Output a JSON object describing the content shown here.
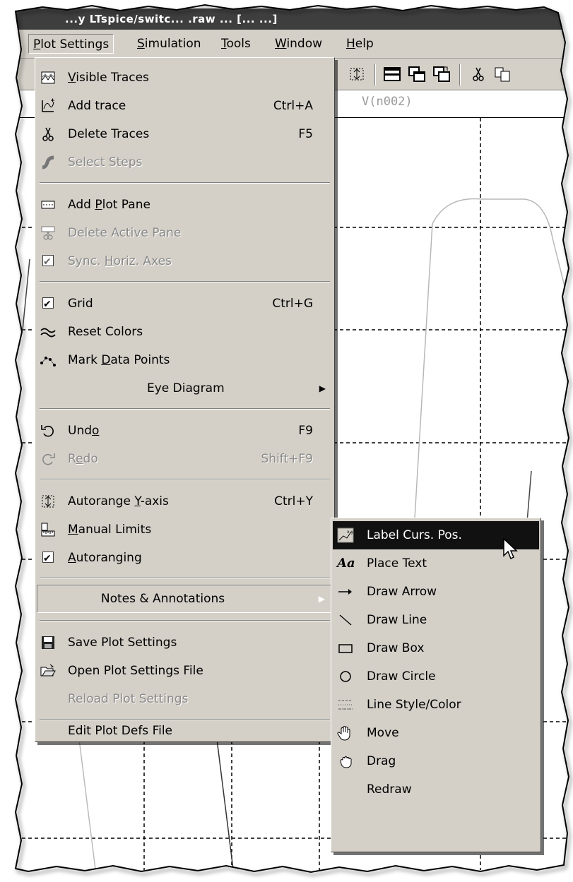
{
  "window": {
    "title": "...y LTspice/switc... .raw ... [... ...]"
  },
  "menubar": {
    "items": [
      {
        "label": "Plot Settings",
        "ul": "P",
        "open": true
      },
      {
        "label": "Simulation",
        "ul": "S"
      },
      {
        "label": "Tools",
        "ul": "T"
      },
      {
        "label": "Window",
        "ul": "W"
      },
      {
        "label": "Help",
        "ul": "H"
      }
    ]
  },
  "plot": {
    "trace_label": "V(n002)"
  },
  "menu": {
    "visible_traces": {
      "label": "Visible Traces",
      "icon": "visible-traces-icon"
    },
    "add_trace": {
      "label": "Add trace",
      "shortcut": "Ctrl+A",
      "icon": "add-trace-icon"
    },
    "delete_traces": {
      "label": "Delete Traces",
      "shortcut": "F5",
      "icon": "scissors-icon"
    },
    "select_steps": {
      "label": "Select Steps",
      "disabled": true,
      "icon": "select-steps-icon"
    },
    "add_plot_pane": {
      "label": "Add Plot Pane",
      "icon": "add-pane-icon"
    },
    "delete_active_pane": {
      "label": "Delete Active Pane",
      "disabled": true,
      "icon": "delete-pane-icon"
    },
    "sync_horiz_axes": {
      "label": "Sync. Horiz. Axes",
      "checked": true,
      "disabled": true
    },
    "grid": {
      "label": "Grid",
      "shortcut": "Ctrl+G",
      "checked": true
    },
    "reset_colors": {
      "label": "Reset Colors",
      "icon": "wave-icon"
    },
    "mark_data_points": {
      "label": "Mark Data Points",
      "icon": "data-points-icon"
    },
    "eye_diagram": {
      "label": "Eye Diagram"
    },
    "undo": {
      "label": "Undo",
      "shortcut": "F9",
      "icon": "undo-icon"
    },
    "redo": {
      "label": "Redo",
      "shortcut": "Shift+F9",
      "disabled": true,
      "icon": "redo-icon"
    },
    "autorange_y": {
      "label": "Autorange Y-axis",
      "shortcut": "Ctrl+Y",
      "icon": "autorange-icon"
    },
    "manual_limits": {
      "label": "Manual Limits",
      "icon": "ruler-icon"
    },
    "autoranging": {
      "label": "Autoranging",
      "checked": true
    },
    "notes_annotations": {
      "label": "Notes & Annotations"
    },
    "save_plot_settings": {
      "label": "Save Plot Settings",
      "icon": "save-icon"
    },
    "open_plot_settings": {
      "label": "Open Plot Settings File",
      "icon": "open-folder-icon"
    },
    "reload_plot_settings": {
      "label": "Reload Plot Settings",
      "disabled": true
    },
    "edit_plot_defs": {
      "label": "Edit Plot Defs File"
    }
  },
  "submenu": {
    "items": [
      {
        "label": "Label Curs. Pos.",
        "icon": "label-cursor-icon",
        "highlighted": true
      },
      {
        "label": "Place Text",
        "icon": "text-aa-icon"
      },
      {
        "label": "Draw Arrow",
        "icon": "arrow-icon"
      },
      {
        "label": "Draw Line",
        "icon": "line-icon"
      },
      {
        "label": "Draw Box",
        "icon": "box-icon"
      },
      {
        "label": "Draw Circle",
        "icon": "circle-icon"
      },
      {
        "label": "Line Style/Color",
        "icon": "line-style-icon"
      },
      {
        "label": "Move",
        "icon": "hand-open-icon"
      },
      {
        "label": "Drag",
        "icon": "hand-grab-icon"
      },
      {
        "label": "Redraw",
        "icon": ""
      }
    ]
  }
}
